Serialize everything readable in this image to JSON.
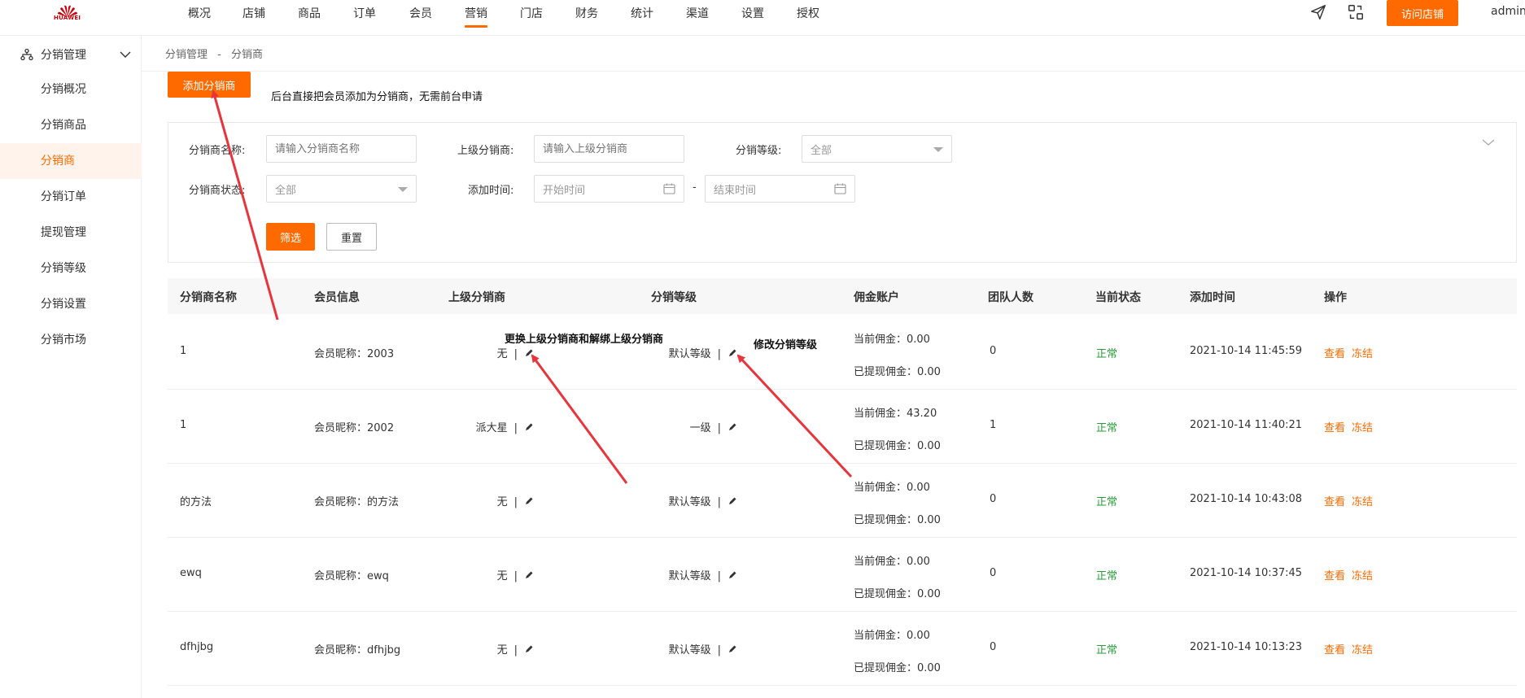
{
  "brand": {
    "logo_text": "HUAWEI"
  },
  "nav": {
    "items": [
      "概况",
      "店铺",
      "商品",
      "订单",
      "会员",
      "营销",
      "门店",
      "财务",
      "统计",
      "渠道",
      "设置",
      "授权"
    ],
    "active_index": 5,
    "visit_button": "访问店铺",
    "user": "admin"
  },
  "sidebar": {
    "header": "分销管理",
    "items": [
      "分销概况",
      "分销商品",
      "分销商",
      "分销订单",
      "提现管理",
      "分销等级",
      "分销设置",
      "分销市场"
    ],
    "active_index": 2
  },
  "breadcrumb": {
    "parent": "分销管理",
    "sep": "-",
    "current": "分销商"
  },
  "actions": {
    "add_button": "添加分销商",
    "add_note": "后台直接把会员添加为分销商，无需前台申请"
  },
  "filter": {
    "name_label": "分销商名称:",
    "name_placeholder": "请输入分销商名称",
    "parent_label": "上级分销商:",
    "parent_placeholder": "请输入上级分销商",
    "level_label": "分销等级:",
    "level_value": "全部",
    "status_label": "分销商状态:",
    "status_value": "全部",
    "time_label": "添加时间:",
    "start_placeholder": "开始时间",
    "end_placeholder": "结束时间",
    "range_sep": "-",
    "submit": "筛选",
    "reset": "重置"
  },
  "table": {
    "headers": [
      "分销商名称",
      "会员信息",
      "上级分销商",
      "分销等级",
      "佣金账户",
      "团队人数",
      "当前状态",
      "添加时间",
      "操作"
    ],
    "rows": [
      {
        "name": "1",
        "member": "会员昵称：2003",
        "parent": "无",
        "level": "默认等级",
        "current": "当前佣金：0.00",
        "withdrawn": "已提现佣金：0.00",
        "team": "0",
        "status": "正常",
        "time": "2021-10-14 11:45:59",
        "view": "查看",
        "freeze": "冻结"
      },
      {
        "name": "1",
        "member": "会员昵称：2002",
        "parent": "派大星",
        "level": "一级",
        "current": "当前佣金：43.20",
        "withdrawn": "已提现佣金：0.00",
        "team": "1",
        "status": "正常",
        "time": "2021-10-14 11:40:21",
        "view": "查看",
        "freeze": "冻结"
      },
      {
        "name": "的方法",
        "member": "会员昵称：的方法",
        "parent": "无",
        "level": "默认等级",
        "current": "当前佣金：0.00",
        "withdrawn": "已提现佣金：0.00",
        "team": "0",
        "status": "正常",
        "time": "2021-10-14 10:43:08",
        "view": "查看",
        "freeze": "冻结"
      },
      {
        "name": "ewq",
        "member": "会员昵称：ewq",
        "parent": "无",
        "level": "默认等级",
        "current": "当前佣金：0.00",
        "withdrawn": "已提现佣金：0.00",
        "team": "0",
        "status": "正常",
        "time": "2021-10-14 10:37:45",
        "view": "查看",
        "freeze": "冻结"
      },
      {
        "name": "dfhjbg",
        "member": "会员昵称：dfhjbg",
        "parent": "无",
        "level": "默认等级",
        "current": "当前佣金：0.00",
        "withdrawn": "已提现佣金：0.00",
        "team": "0",
        "status": "正常",
        "time": "2021-10-14 10:13:23",
        "view": "查看",
        "freeze": "冻结"
      }
    ]
  },
  "annotations": {
    "parent_note": "更换上级分销商和解绑上级分销商",
    "level_note": "修改分销等级"
  },
  "colors": {
    "accent": "#ff6a00",
    "status_ok": "#2a9d3a",
    "arrow": "#e8343a"
  }
}
